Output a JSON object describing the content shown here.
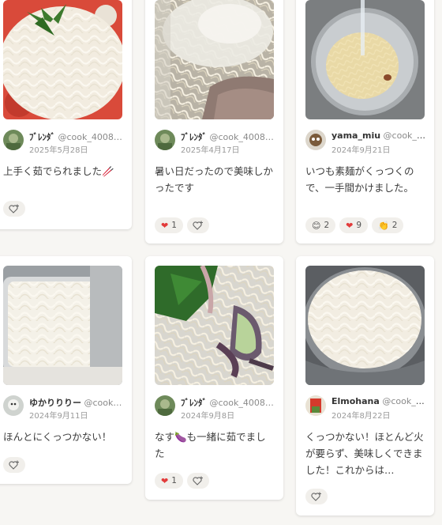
{
  "cards": [
    {
      "user": {
        "name": "ﾌﾞﾚﾝﾀﾞ",
        "handle": "@cook_4008…"
      },
      "date": "2025年5月28日",
      "text": "上手く茹でられました🥢",
      "reactions": []
    },
    {
      "user": {
        "name": "ﾌﾞﾚﾝﾀﾞ",
        "handle": "@cook_4008…"
      },
      "date": "2025年4月17日",
      "text": "暑い日だったので美味しかったです",
      "reactions": [
        {
          "icon": "heart-icon",
          "count": "1"
        }
      ]
    },
    {
      "user": {
        "name": "yama_miu",
        "handle": "@cook_4…"
      },
      "date": "2024年9月21日",
      "text": "いつも素麺がくっつくので、一手間かけました。",
      "reactions": [
        {
          "icon": "smile-icon",
          "count": "2"
        },
        {
          "icon": "heart-icon",
          "count": "9"
        },
        {
          "icon": "clap-icon",
          "count": "2"
        }
      ]
    },
    {
      "user": {
        "name": "ゆかりりりー",
        "handle": "@cook…"
      },
      "date": "2024年9月11日",
      "text": "ほんとにくっつかない！",
      "reactions": []
    },
    {
      "user": {
        "name": "ﾌﾞﾚﾝﾀﾞ",
        "handle": "@cook_4008…"
      },
      "date": "2024年9月8日",
      "text": "なす🍆も一緒に茹でました",
      "reactions": [
        {
          "icon": "heart-icon",
          "count": "1"
        }
      ]
    },
    {
      "user": {
        "name": "Elmohana",
        "handle": "@cook_4…"
      },
      "date": "2024年8月22日",
      "text": "くっつかない！ほとんど火が要らず、美味しくできました！これからは…",
      "reactions": []
    }
  ],
  "icons": {
    "heart": "❤",
    "smile": "😊",
    "clap": "👏",
    "add_reaction": "add-reaction-icon"
  },
  "colors": {
    "background": "#f7f6f3",
    "card": "#ffffff",
    "pill": "#f1efeb",
    "heart": "#e23b3b"
  }
}
